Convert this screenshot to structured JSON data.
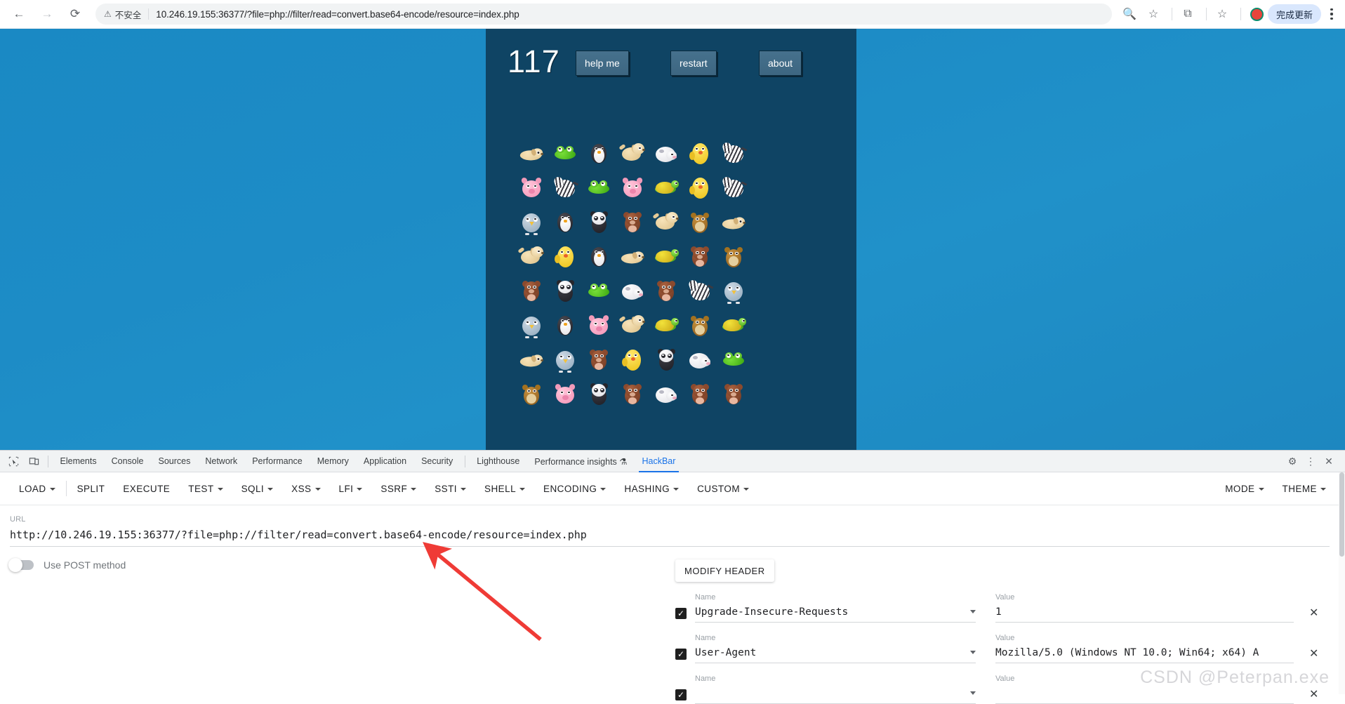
{
  "browser": {
    "back_icon": "arrow-left",
    "forward_icon": "arrow-right",
    "reload_icon": "reload",
    "security_label": "不安全",
    "url": "10.246.19.155:36377/?file=php://filter/read=convert.base64-encode/resource=index.php",
    "update_button": "完成更新",
    "icons": [
      "zoom-icon",
      "bookmark-star-icon",
      "extensions-puzzle-icon",
      "bookmark-manager-icon",
      "profile-avatar",
      "kebab-menu-icon"
    ]
  },
  "game": {
    "score": "117",
    "buttons": {
      "help": "help me",
      "restart": "restart",
      "about": "about"
    },
    "panel_bg": "#0f4464",
    "page_bg": "#1d8cc6",
    "grid": {
      "cols": 7,
      "rows": 8,
      "tiles": [
        [
          "dog-sleep",
          "frog",
          "penguin",
          "dog",
          "sheep",
          "chick",
          "zebra"
        ],
        [
          "pig",
          "zebra",
          "frog",
          "pig",
          "turtle",
          "chick",
          "zebra"
        ],
        [
          "bird",
          "penguin",
          "panda",
          "bear",
          "dog",
          "hamster",
          "dog-sleep"
        ],
        [
          "dog",
          "chick",
          "penguin",
          "dog-sleep",
          "turtle",
          "bear",
          "hamster"
        ],
        [
          "bear",
          "panda",
          "frog",
          "sheep",
          "bear",
          "zebra",
          "bird"
        ],
        [
          "bird",
          "penguin",
          "pig",
          "dog",
          "turtle",
          "hamster",
          "turtle"
        ],
        [
          "dog-sleep",
          "bird",
          "bear",
          "chick",
          "panda",
          "sheep",
          "frog"
        ],
        [
          "hamster",
          "pig",
          "panda",
          "bear",
          "sheep",
          "bear",
          "bear"
        ]
      ]
    }
  },
  "devtools": {
    "left_icons": [
      "inspect-element-icon",
      "device-toolbar-icon"
    ],
    "tabs": [
      {
        "label": "Elements",
        "selected": false
      },
      {
        "label": "Console",
        "selected": false
      },
      {
        "label": "Sources",
        "selected": false
      },
      {
        "label": "Network",
        "selected": false
      },
      {
        "label": "Performance",
        "selected": false
      },
      {
        "label": "Memory",
        "selected": false
      },
      {
        "label": "Application",
        "selected": false
      },
      {
        "label": "Security",
        "selected": false
      }
    ],
    "tabs2": [
      {
        "label": "Lighthouse",
        "selected": false
      },
      {
        "label": "Performance insights ⚗",
        "selected": false
      },
      {
        "label": "HackBar",
        "selected": true
      }
    ],
    "right_icons": [
      "gear-icon",
      "more-vertical-icon",
      "close-icon"
    ]
  },
  "hackbar": {
    "toolbar": [
      {
        "label": "LOAD",
        "caret": true
      },
      {
        "label": "SPLIT",
        "caret": false
      },
      {
        "label": "EXECUTE",
        "caret": false
      },
      {
        "label": "TEST",
        "caret": true
      },
      {
        "label": "SQLI",
        "caret": true
      },
      {
        "label": "XSS",
        "caret": true
      },
      {
        "label": "LFI",
        "caret": true
      },
      {
        "label": "SSRF",
        "caret": true
      },
      {
        "label": "SSTI",
        "caret": true
      },
      {
        "label": "SHELL",
        "caret": true
      },
      {
        "label": "ENCODING",
        "caret": true
      },
      {
        "label": "HASHING",
        "caret": true
      },
      {
        "label": "CUSTOM",
        "caret": true
      }
    ],
    "toolbar_right": [
      {
        "label": "MODE",
        "caret": true
      },
      {
        "label": "THEME",
        "caret": true
      }
    ],
    "url_label": "URL",
    "url_value": "http://10.246.19.155:36377/?file=php://filter/read=convert.base64-encode/resource=index.php",
    "post_toggle_label": "Use POST method",
    "post_toggle_on": false,
    "modify_header_button": "MODIFY HEADER",
    "headers": [
      {
        "checked": true,
        "name_label": "Name",
        "name": "Upgrade-Insecure-Requests",
        "value_label": "Value",
        "value": "1",
        "remove": "✕"
      },
      {
        "checked": true,
        "name_label": "Name",
        "name": "User-Agent",
        "value_label": "Value",
        "value": "Mozilla/5.0 (Windows NT 10.0; Win64; x64) A",
        "remove": "✕"
      },
      {
        "checked": true,
        "name_label": "Name",
        "name": "",
        "value_label": "Value",
        "value": "",
        "remove": "✕"
      }
    ]
  },
  "annotation": {
    "arrow_color": "#ef3b36",
    "watermark": "CSDN @Peterpan.exe"
  }
}
